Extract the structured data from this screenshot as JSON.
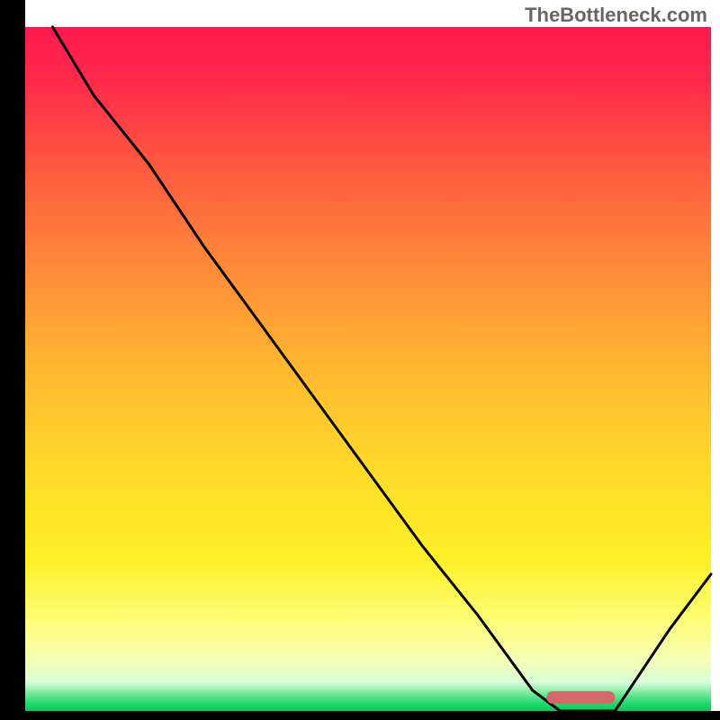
{
  "watermark": "TheBottleneck.com",
  "chart_data": {
    "type": "line",
    "title": "",
    "xlabel": "",
    "ylabel": "",
    "xlim": [
      0,
      100
    ],
    "ylim": [
      0,
      100
    ],
    "x": [
      4,
      10,
      18,
      26,
      34,
      42,
      50,
      58,
      66,
      74,
      78,
      82,
      86,
      94,
      100
    ],
    "values": [
      100,
      90,
      80,
      68,
      57,
      46,
      35,
      24,
      14,
      3,
      0,
      0,
      0,
      12,
      20
    ],
    "minimum_band": {
      "start": 76,
      "end": 86
    },
    "gradient_stops": [
      {
        "offset": 0.0,
        "color": "#ff1a4d"
      },
      {
        "offset": 0.08,
        "color": "#ff2a4a"
      },
      {
        "offset": 0.2,
        "color": "#ff5840"
      },
      {
        "offset": 0.35,
        "color": "#ff8a38"
      },
      {
        "offset": 0.5,
        "color": "#ffb830"
      },
      {
        "offset": 0.65,
        "color": "#ffdb28"
      },
      {
        "offset": 0.78,
        "color": "#fff028"
      },
      {
        "offset": 0.86,
        "color": "#fdfd70"
      },
      {
        "offset": 0.92,
        "color": "#f8ffb0"
      },
      {
        "offset": 0.958,
        "color": "#d8ffd8"
      },
      {
        "offset": 0.975,
        "color": "#70e898"
      },
      {
        "offset": 0.99,
        "color": "#18d868"
      },
      {
        "offset": 1.0,
        "color": "#10c860"
      }
    ],
    "curve_color": "#000000",
    "frame_color": "#000000",
    "band_color": "#d6676a"
  }
}
